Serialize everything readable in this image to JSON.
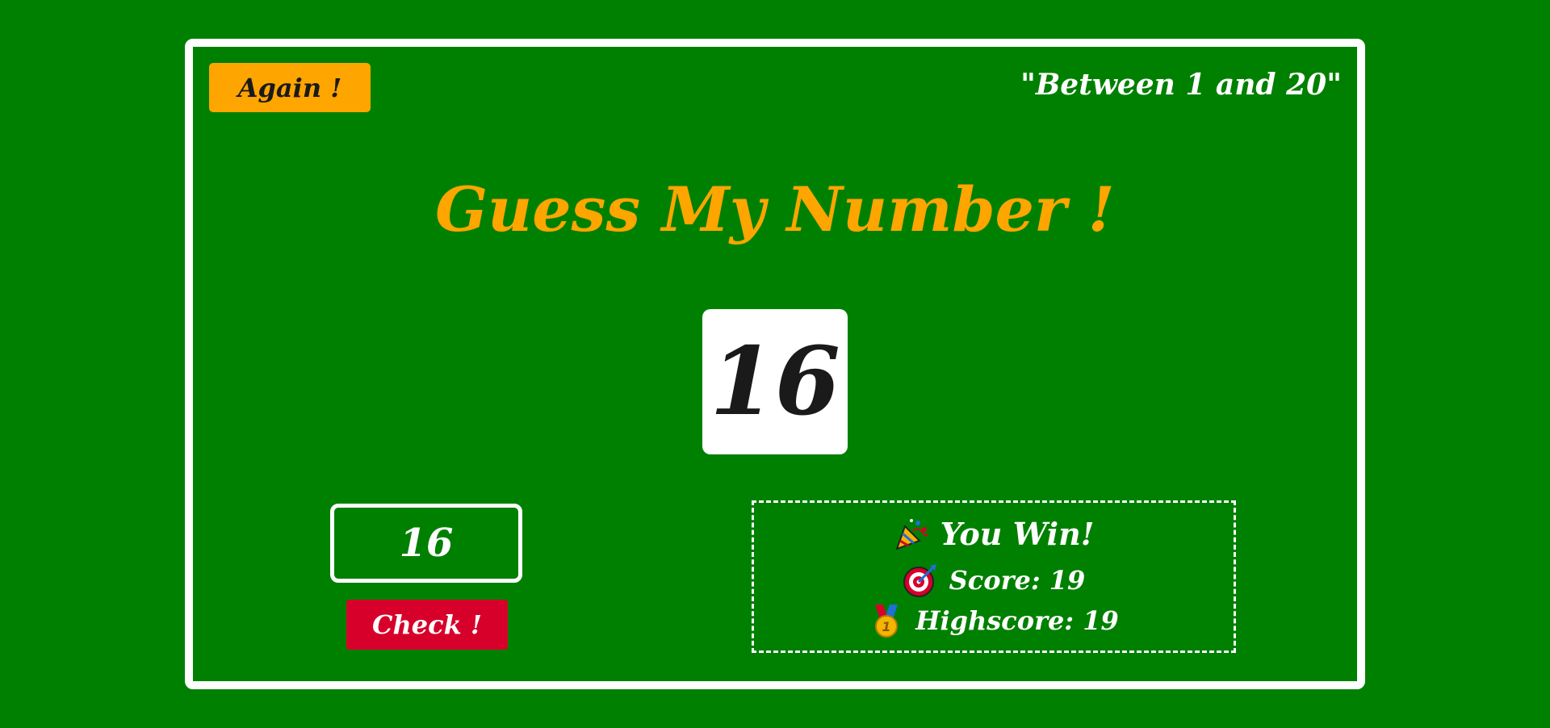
{
  "game": {
    "again_label": "Again !",
    "range_hint": "\"Between 1 and 20\"",
    "title": "Guess My Number !",
    "secret_number": "16",
    "guess_value": "16",
    "check_label": "Check !",
    "message": "You Win!",
    "score_text": "Score: 19",
    "highscore_text": "Highscore: 19"
  },
  "icons": {
    "message": "party-popper-icon",
    "score": "target-icon",
    "highscore": "medal-icon"
  },
  "colors": {
    "background": "#008000",
    "accent": "#ffa500",
    "check_button": "#d6002a",
    "frame": "#ffffff",
    "text_dark": "#1a1a1a"
  }
}
